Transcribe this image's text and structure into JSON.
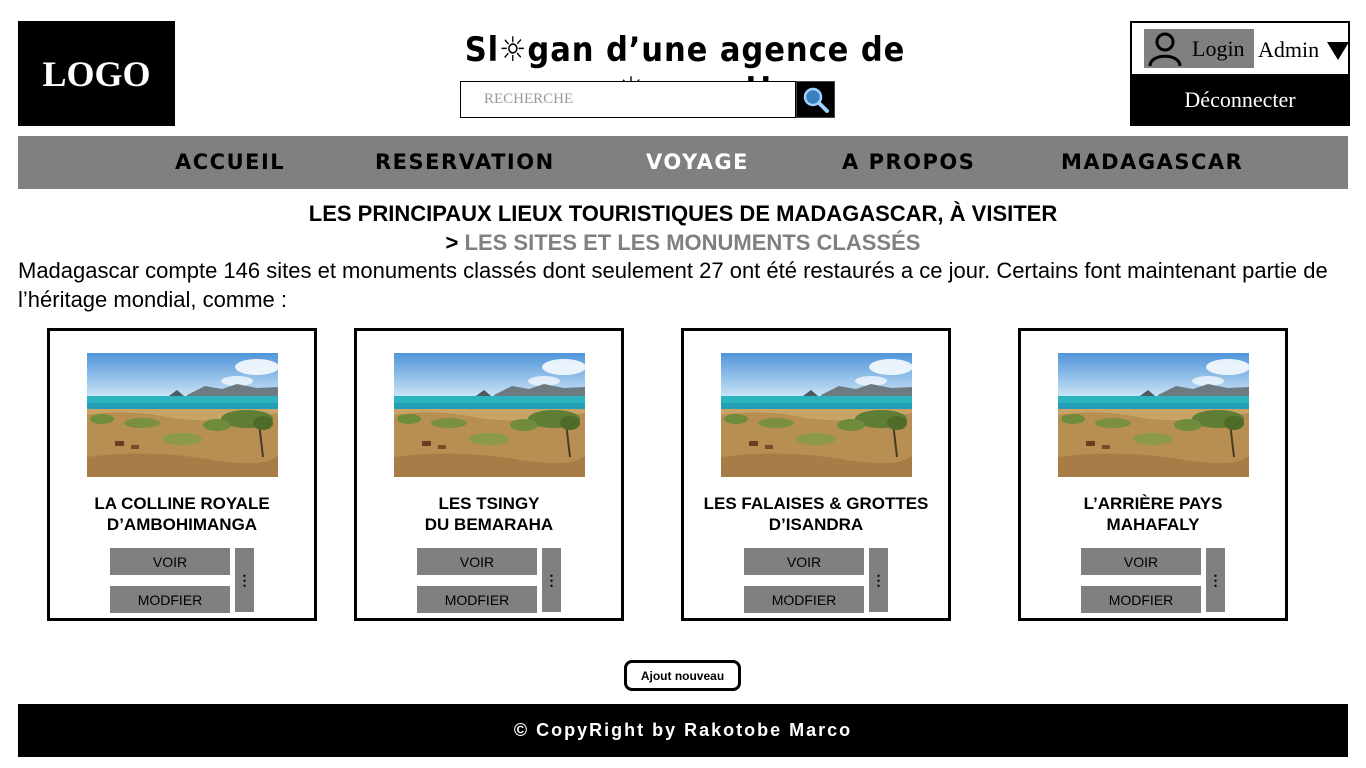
{
  "header": {
    "logo": "LOGO",
    "slogan": "Sl☼gan d’une agence de v☼yage !!",
    "search": {
      "placeholder": "RECHERCHE",
      "value": ""
    },
    "search_icon": "search-icon"
  },
  "account": {
    "login_label": "Login",
    "user_name": "Admin",
    "logout_label": "Déconnecter",
    "user_icon": "user-icon",
    "caret_icon": "caret-down-icon"
  },
  "nav": {
    "items": [
      {
        "label": "ACCUEIL",
        "active": false
      },
      {
        "label": "RESERVATION",
        "active": false
      },
      {
        "label": "VOYAGE",
        "active": true
      },
      {
        "label": "A PROPOS",
        "active": false
      },
      {
        "label": "MADAGASCAR",
        "active": false
      }
    ]
  },
  "main": {
    "title": "LES PRINCIPAUX LIEUX TOURISTIQUES DE MADAGASCAR, À VISITER",
    "subtitle_prefix": ">",
    "subtitle": "LES SITES ET LES MONUMENTS CLASSÉS",
    "intro": "Madagascar compte 146 sites et monuments classés dont seulement 27 ont été restaurés a ce jour. Certains font maintenant partie de l’héritage mondial, comme :",
    "cards": [
      {
        "title_line1": "LA COLLINE ROYALE",
        "title_line2": "D’AMBOHIMANGA",
        "view_label": "VOIR",
        "edit_label": "MODFIER",
        "menu_label": "⋮"
      },
      {
        "title_line1": "LES TSINGY",
        "title_line2": "DU BEMARAHA",
        "view_label": "VOIR",
        "edit_label": "MODFIER",
        "menu_label": "⋮"
      },
      {
        "title_line1": "LES FALAISES & GROTTES",
        "title_line2": "D’ISANDRA",
        "view_label": "VOIR",
        "edit_label": "MODFIER",
        "menu_label": "⋮"
      },
      {
        "title_line1": "L’ARRIÈRE PAYS",
        "title_line2": "MAHAFALY",
        "view_label": "VOIR",
        "edit_label": "MODFIER",
        "menu_label": "⋮"
      }
    ],
    "add_label": "Ajout nouveau"
  },
  "footer": {
    "text": "© CopyRight by Rakotobe Marco"
  },
  "colors": {
    "gray": "#808080",
    "black": "#000000",
    "white": "#ffffff",
    "sea": "#2bb3c0",
    "sky": "#7fb8e6",
    "sand": "#c9a467"
  }
}
